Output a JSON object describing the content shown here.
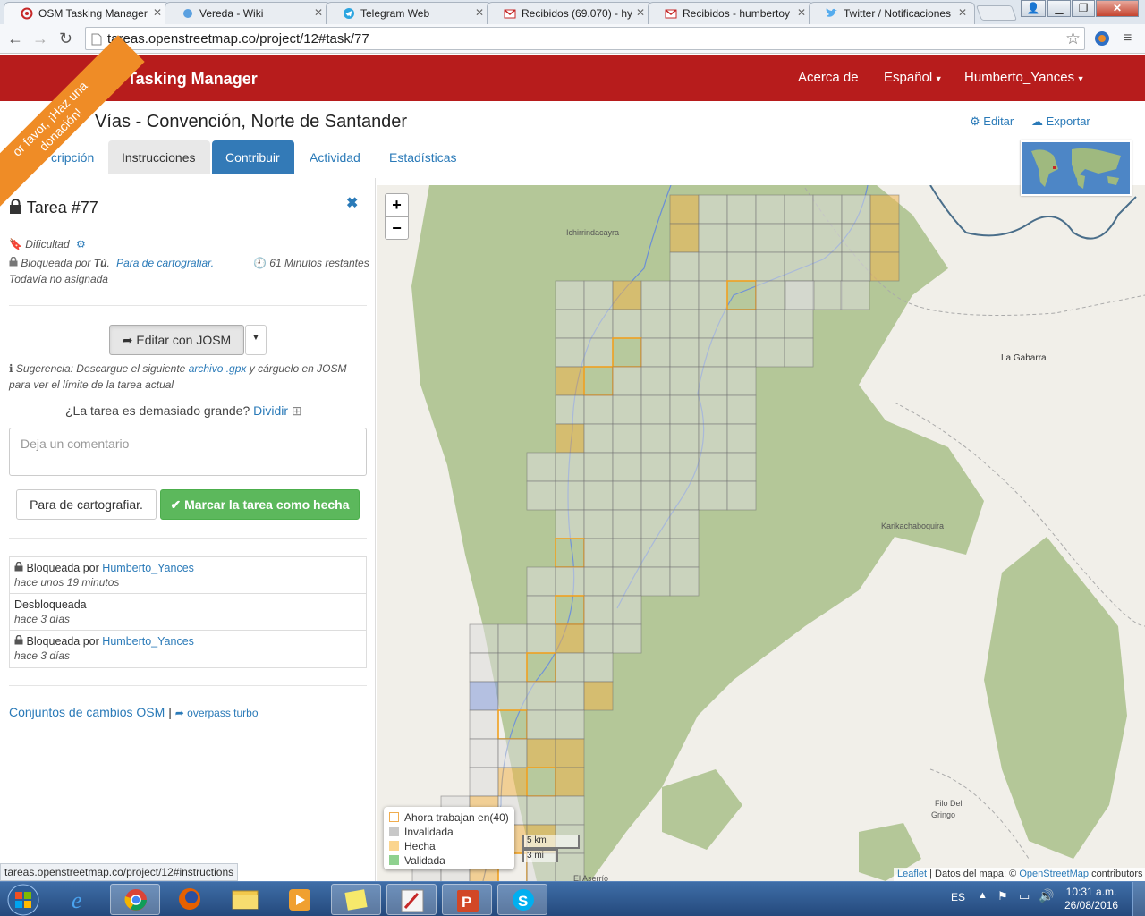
{
  "browser": {
    "tabs": [
      {
        "label": "OSM Tasking Manager",
        "icon": "osm-logo-icon"
      },
      {
        "label": "Vereda - Wiki",
        "icon": "puzzle-icon"
      },
      {
        "label": "Telegram Web",
        "icon": "telegram-icon"
      },
      {
        "label": "Recibidos (69.070) - hy",
        "icon": "gmail-icon"
      },
      {
        "label": "Recibidos - humbertoy",
        "icon": "gmail-icon"
      },
      {
        "label": "Twitter / Notificaciones",
        "icon": "twitter-icon"
      }
    ],
    "url": "tareas.openstreetmap.co/project/12#task/77",
    "status_url": "tareas.openstreetmap.co/project/12#instructions"
  },
  "site": {
    "brand": "Tasking Manager",
    "nav": {
      "about": "Acerca de",
      "language": "Español",
      "user": "Humberto_Yances"
    },
    "ribbon": "Por favor, ¡Haz una donación!",
    "ribbon_line1": "or favor, ¡Haz una",
    "ribbon_line2": "donación!"
  },
  "project": {
    "title": "Vías - Convención, Norte de Santander",
    "edit_link": "Editar",
    "export_link": "Exportar",
    "tabs": [
      "cripción",
      "Instrucciones",
      "Contribuir",
      "Actividad",
      "Estadísticas"
    ],
    "active_tab": "Contribuir"
  },
  "task": {
    "title": "Tarea #77",
    "difficulty_label": "Dificultad",
    "locked_by_prefix": "Bloqueada por",
    "locked_by_user": "Tú",
    "stop_mapping_link": "Para de cartografiar.",
    "time_left": "61 Minutos restantes",
    "unassigned": "Todavía no asignada",
    "edit_button": "Editar con JOSM",
    "hint_prefix": "Sugerencia: Descargue el siguiente",
    "hint_link": "archivo .gpx",
    "hint_suffix": "y cárguelo en JOSM",
    "hint_line2": "para ver el límite de la tarea actual",
    "too_big": "¿La tarea es demasiado grande?",
    "split_link": "Dividir",
    "comment_placeholder": "Deja un comentario",
    "stop_button": "Para de cartografiar.",
    "done_button": "Marcar la tarea como hecha",
    "history": [
      {
        "action": "Bloqueada por",
        "user": "Humberto_Yances",
        "time": "hace unos 19 minutos",
        "locked": true
      },
      {
        "action": "Desbloqueada",
        "user": "",
        "time": "hace 3 días",
        "locked": false
      },
      {
        "action": "Bloqueada por",
        "user": "Humberto_Yances",
        "time": "hace 3 días",
        "locked": true
      }
    ],
    "changesets_link": "Conjuntos de cambios OSM",
    "separator": "|",
    "overpass_link": "overpass turbo"
  },
  "map": {
    "place_labels": [
      "Ichirrindacayra",
      "La Gabarra",
      "Karikachaboquira",
      "Filo Del",
      "Gringo",
      "El Aserrío"
    ],
    "scale_km": "5 km",
    "scale_mi": "3 mi",
    "legend": [
      {
        "label": "Ahora trabajan en(40)",
        "color": "#ffffff",
        "border": "#f0ad4e"
      },
      {
        "label": "Invalidada",
        "color": "#c8c8c8",
        "border": "#c8c8c8"
      },
      {
        "label": "Hecha",
        "color": "#fbd58f",
        "border": "#fbd58f"
      },
      {
        "label": "Validada",
        "color": "#8fd18f",
        "border": "#8fd18f"
      }
    ],
    "attribution_leaflet": "Leaflet",
    "attribution_data": "| Datos del mapa: ©",
    "attribution_osm": "OpenStreetMap",
    "attribution_suffix": "contributors"
  },
  "taskbar": {
    "lang": "ES",
    "time": "10:31 a.m.",
    "date": "26/08/2016"
  }
}
